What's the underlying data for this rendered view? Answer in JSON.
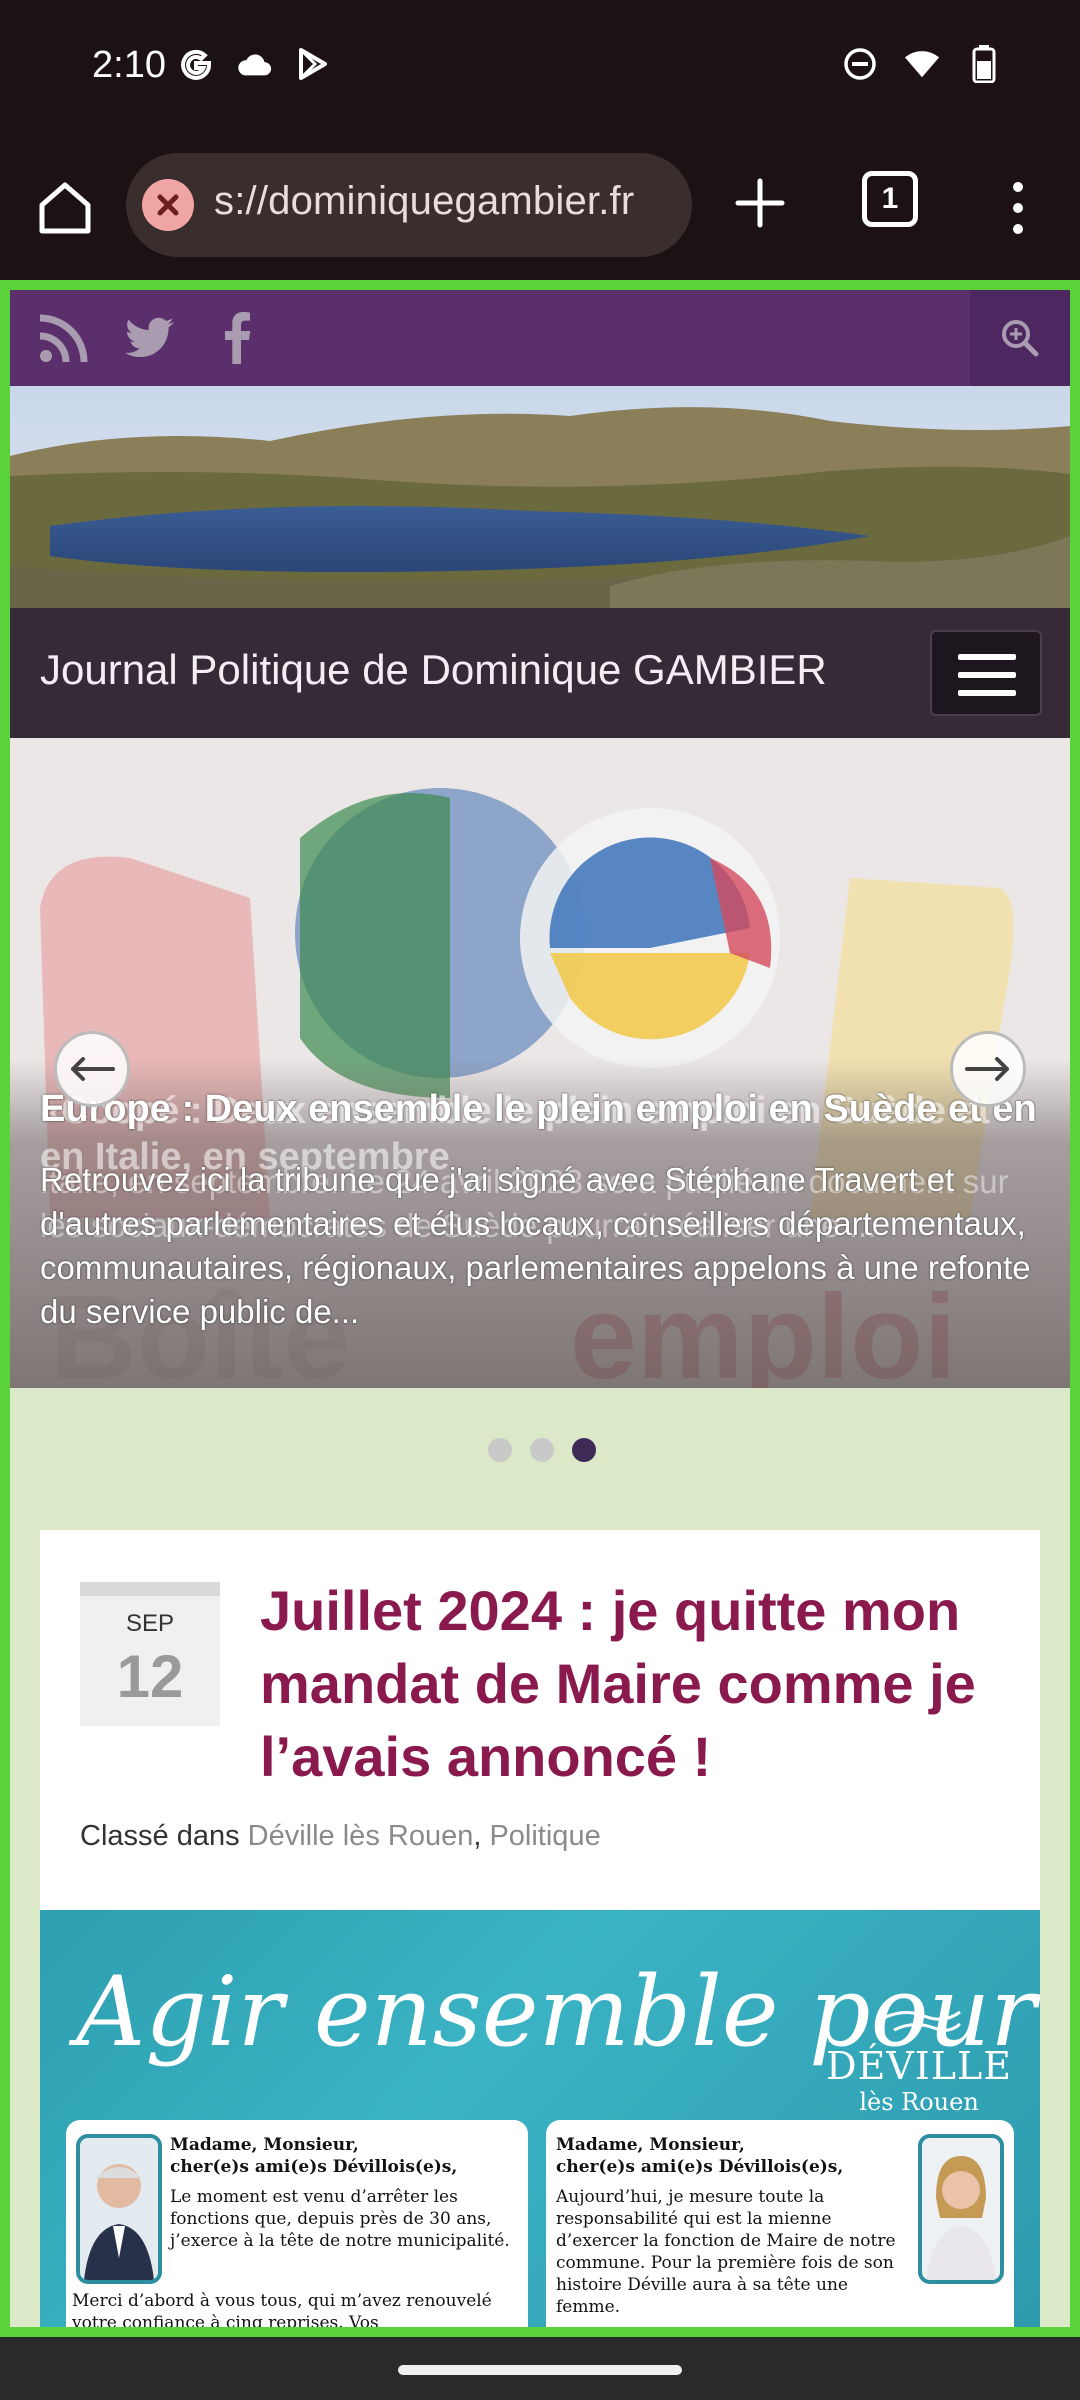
{
  "status_bar": {
    "time": "2:10",
    "left_icons": [
      "google-icon",
      "cloud-icon",
      "play-store-icon"
    ],
    "right_icons": [
      "dnd-icon",
      "wifi-icon",
      "battery-icon"
    ]
  },
  "browser": {
    "url": "s://dominiquegambier.fr",
    "tab_count": "1"
  },
  "site": {
    "social_icons": [
      "rss-icon",
      "twitter-icon",
      "facebook-icon"
    ],
    "title": "Journal Politique de Dominique GAMBIER"
  },
  "slider": {
    "caption_title_front": "Europe : Deux ensemble le plein emploi en Suède et en",
    "caption_title_back": "«Coopé : Deux ensemble le plein emploi en Suède et en Italie, en septembre",
    "caption_text_front": "Retrouvez ici la tribune que j'ai signé avec Stéphane Travert et d'autres parlementaires et élus locaux, conseillers départementaux, communautaires, régionaux, parlementaires appelons à une refonte du service public de...",
    "caption_text_back": "Italie, en septembre. Le 24 avril 2023 sera publié un document sur les sociaux-démocrates de Suède pourrait réaliser une ...",
    "dots_total": 3,
    "dots_active_index": 2
  },
  "article": {
    "date_month": "SEP",
    "date_day": "12",
    "title": "Juillet 2024 : je quitte mon mandat de Maire comme je l’avais annoncé !",
    "meta_prefix": "Classé dans ",
    "category_1": "Déville lès Rouen",
    "category_sep": ", ",
    "category_2": "Politique",
    "image": {
      "headline": "Agir ensemble pour",
      "brand_1": "DÉVILLE",
      "brand_2": "lès Rouen",
      "left_greeting_1": "Madame, Monsieur,",
      "left_greeting_2": "cher(e)s ami(e)s Dévillois(e)s,",
      "left_body": "Le moment est venu d’arrêter les fonctions que, depuis près de 30 ans, j’exerce à la tête de notre municipalité.",
      "left_body_2": "Merci d’abord à vous tous, qui m’avez renouvelé votre confiance à cinq reprises. Vos encouragements",
      "right_greeting_1": "Madame, Monsieur,",
      "right_greeting_2": "cher(e)s ami(e)s Dévillois(e)s,",
      "right_body": "Aujourd’hui, je mesure toute la responsabilité qui est la mienne d’exercer la fonction de Maire de notre commune. Pour la première fois de son histoire Déville aura à sa tête une femme."
    }
  },
  "colors": {
    "topbar": "#5b2f6b",
    "titlebar": "#362a36",
    "page_bg": "#dce9c9",
    "article_title": "#8a1a4e",
    "frame": "#5ad33a"
  }
}
